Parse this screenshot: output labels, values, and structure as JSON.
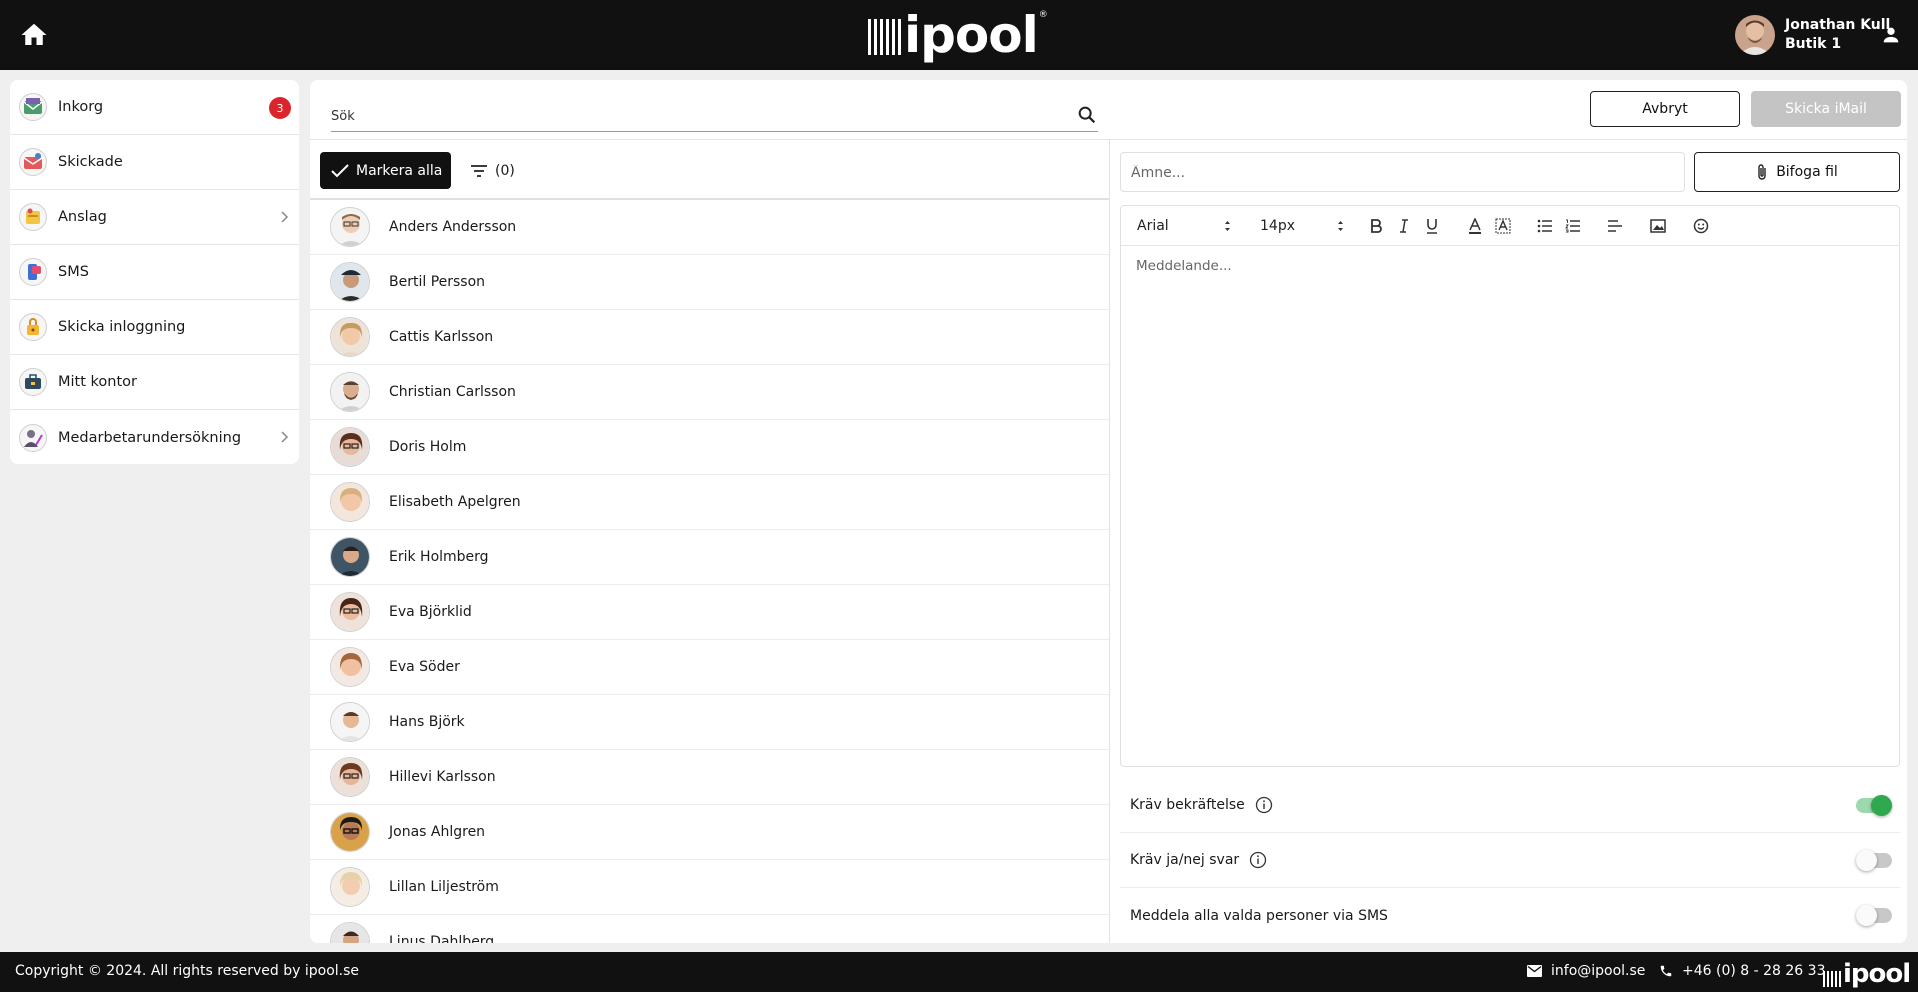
{
  "header": {
    "brand": "ipool",
    "brand_mark": "®",
    "user_name": "Jonathan Kull",
    "user_store": "Butik 1"
  },
  "sidebar": {
    "items": [
      {
        "label": "Inkorg",
        "icon": "inbox-icon",
        "badge": "3"
      },
      {
        "label": "Skickade",
        "icon": "sent-mail-icon"
      },
      {
        "label": "Anslag",
        "icon": "notice-board-icon",
        "chevron": true
      },
      {
        "label": "SMS",
        "icon": "sms-icon"
      },
      {
        "label": "Skicka inloggning",
        "icon": "login-lock-icon"
      },
      {
        "label": "Mitt kontor",
        "icon": "office-icon"
      },
      {
        "label": "Medarbetarundersökning",
        "icon": "survey-icon",
        "chevron": true
      }
    ]
  },
  "search": {
    "placeholder": "Sök"
  },
  "actions": {
    "cancel_label": "Avbryt",
    "send_label": "Skicka iMail"
  },
  "list_controls": {
    "mark_all_label": "Markera alla",
    "filter_count": "(0)"
  },
  "people": [
    {
      "name": "Anders Andersson"
    },
    {
      "name": "Bertil Persson"
    },
    {
      "name": "Cattis Karlsson"
    },
    {
      "name": "Christian Carlsson"
    },
    {
      "name": "Doris Holm"
    },
    {
      "name": "Elisabeth Apelgren"
    },
    {
      "name": "Erik Holmberg"
    },
    {
      "name": "Eva Björklid"
    },
    {
      "name": "Eva Söder"
    },
    {
      "name": "Hans Björk"
    },
    {
      "name": "Hillevi Karlsson"
    },
    {
      "name": "Jonas Ahlgren"
    },
    {
      "name": "Lillan Liljeström"
    },
    {
      "name": "Linus Dahlberg"
    }
  ],
  "composer": {
    "subject_placeholder": "Ämne...",
    "attach_label": "Bifoga fil",
    "font_family": "Arial",
    "font_size": "14px",
    "message_placeholder": "Meddelande..."
  },
  "options": [
    {
      "label": "Kräv bekräftelse",
      "info": true,
      "on": true
    },
    {
      "label": "Kräv ja/nej svar",
      "info": true,
      "on": false
    },
    {
      "label": "Meddela alla valda personer via SMS",
      "info": false,
      "on": false
    }
  ],
  "footer": {
    "copyright": "Copyright © 2024. All rights reserved by ipool.se",
    "email": "info@ipool.se",
    "phone": "+46 (0) 8 - 28 26 33",
    "brand": "ipool"
  },
  "colors": {
    "header_bg": "#111111",
    "badge": "#d9262c",
    "toggle_on": "#2fa84f",
    "send_disabled": "#c4c4c4"
  }
}
